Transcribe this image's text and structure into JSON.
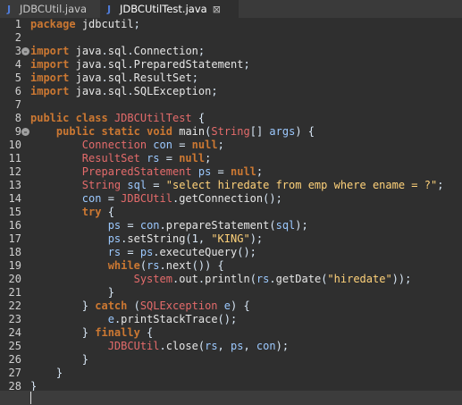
{
  "tabs": [
    {
      "label": "JDBCUtil.java",
      "active": false,
      "icon": "java-file-icon",
      "icon_glyph": "J"
    },
    {
      "label": "JDBCUtilTest.java",
      "active": true,
      "icon": "java-file-icon",
      "icon_glyph": "J",
      "close_glyph": "⊠"
    }
  ],
  "colors": {
    "background": "#2f2f2f",
    "keyword": "#cc7832",
    "class": "#e46b6b",
    "string": "#ffd27a",
    "text": "#e6e6e6"
  },
  "code": {
    "lines": [
      {
        "n": "1",
        "text": "package jdbcutil;"
      },
      {
        "n": "2",
        "text": ""
      },
      {
        "n": "3",
        "text": "import java.sql.Connection;",
        "fold": true
      },
      {
        "n": "4",
        "text": "import java.sql.PreparedStatement;"
      },
      {
        "n": "5",
        "text": "import java.sql.ResultSet;"
      },
      {
        "n": "6",
        "text": "import java.sql.SQLException;"
      },
      {
        "n": "7",
        "text": ""
      },
      {
        "n": "8",
        "text": "public class JDBCUtilTest {"
      },
      {
        "n": "9",
        "text": "    public static void main(String[] args) {",
        "fold": true
      },
      {
        "n": "10",
        "text": "        Connection con = null;"
      },
      {
        "n": "11",
        "text": "        ResultSet rs = null;"
      },
      {
        "n": "12",
        "text": "        PreparedStatement ps = null;"
      },
      {
        "n": "13",
        "text": "        String sql = \"select hiredate from emp where ename = ?\";"
      },
      {
        "n": "14",
        "text": "        con = JDBCUtil.getConnection();"
      },
      {
        "n": "15",
        "text": "        try {"
      },
      {
        "n": "16",
        "text": "            ps = con.prepareStatement(sql);"
      },
      {
        "n": "17",
        "text": "            ps.setString(1, \"KING\");"
      },
      {
        "n": "18",
        "text": "            rs = ps.executeQuery();"
      },
      {
        "n": "19",
        "text": "            while(rs.next()) {"
      },
      {
        "n": "20",
        "text": "                System.out.println(rs.getDate(\"hiredate\"));"
      },
      {
        "n": "21",
        "text": "            }"
      },
      {
        "n": "22",
        "text": "        } catch (SQLException e) {"
      },
      {
        "n": "23",
        "text": "            e.printStackTrace();"
      },
      {
        "n": "24",
        "text": "        } finally {"
      },
      {
        "n": "25",
        "text": "            JDBCUtil.close(rs, ps, con);"
      },
      {
        "n": "26",
        "text": "        }"
      },
      {
        "n": "27",
        "text": "    }"
      },
      {
        "n": "28",
        "text": "}"
      }
    ]
  }
}
